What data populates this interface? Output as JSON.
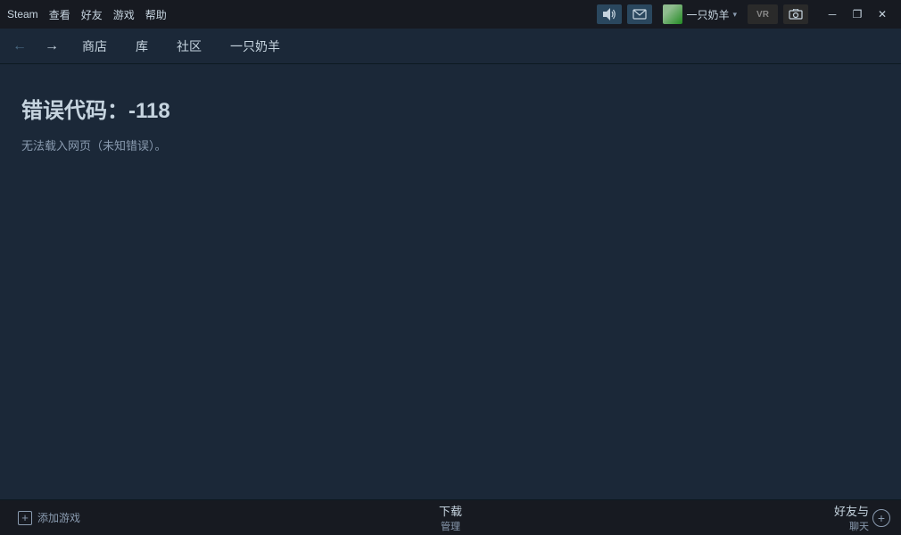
{
  "titlebar": {
    "app_name": "Steam",
    "menus": [
      "Steam",
      "查看",
      "好友",
      "游戏",
      "帮助"
    ],
    "user_name": "一只奶羊",
    "vr_label": "VR",
    "window_controls": {
      "minimize": "－",
      "restore": "❐",
      "close": "✕"
    }
  },
  "navbar": {
    "back_arrow": "←",
    "forward_arrow": "→",
    "items": [
      "商店",
      "库",
      "社区",
      "一只奶羊"
    ]
  },
  "main": {
    "error_title": "错误代码：-118",
    "error_desc": "无法载入网页（未知错误）。"
  },
  "bottombar": {
    "add_game": "添加游戏",
    "download_title": "下载",
    "download_sub": "管理",
    "friends_title": "好友与",
    "chat_title": "聊天"
  }
}
